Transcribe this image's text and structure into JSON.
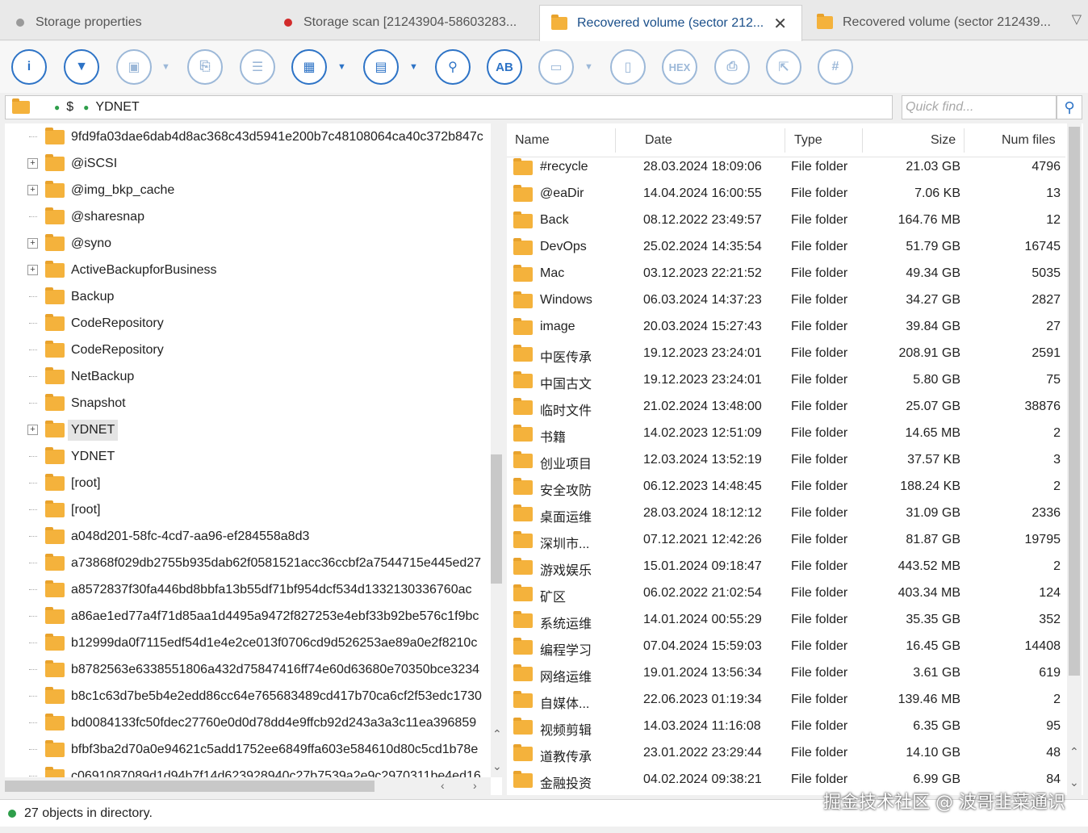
{
  "tabs": [
    {
      "label": "Storage properties",
      "dot_color": "#9a9a9a"
    },
    {
      "label": "Storage scan [21243904-58603283...",
      "dot_color": "#d22b2b"
    },
    {
      "label": "Recovered volume (sector 212...",
      "active": true
    },
    {
      "label": "Recovered volume (sector 212439..."
    }
  ],
  "toolbar": {
    "buttons": [
      {
        "icon": "info-icon",
        "glyph": "i"
      },
      {
        "icon": "filter-icon",
        "glyph": "▼"
      },
      {
        "icon": "save-icon",
        "glyph": "▣"
      },
      {
        "icon": "save-file-icon",
        "glyph": "⎘"
      },
      {
        "icon": "list-icon",
        "glyph": "☰"
      },
      {
        "icon": "view-grid-icon",
        "glyph": "▦"
      },
      {
        "icon": "view-details-icon",
        "glyph": "▤"
      },
      {
        "icon": "binoculars-icon",
        "glyph": "⚲"
      },
      {
        "icon": "text-search-icon",
        "glyph": "AB"
      },
      {
        "icon": "preview-icon",
        "glyph": "▭"
      },
      {
        "icon": "document-icon",
        "glyph": "▯"
      },
      {
        "icon": "hex-icon",
        "glyph": "HEX"
      },
      {
        "icon": "print-icon",
        "glyph": "⎙"
      },
      {
        "icon": "export-icon",
        "glyph": "⇱"
      },
      {
        "icon": "hash-icon",
        "glyph": "#"
      }
    ]
  },
  "path": {
    "root": "$",
    "current": "YDNET"
  },
  "search": {
    "placeholder": "Quick find..."
  },
  "tree": {
    "items": [
      {
        "label": "9fd9fa03dae6dab4d8ac368c43d5941e200b7c48108064ca40c372b847c",
        "expandable": false
      },
      {
        "label": "@iSCSI",
        "expandable": true
      },
      {
        "label": "@img_bkp_cache",
        "expandable": true
      },
      {
        "label": "@sharesnap",
        "expandable": false
      },
      {
        "label": "@syno",
        "expandable": true
      },
      {
        "label": "ActiveBackupforBusiness",
        "expandable": true
      },
      {
        "label": "Backup",
        "expandable": false
      },
      {
        "label": "CodeRepository",
        "expandable": false
      },
      {
        "label": "CodeRepository",
        "expandable": false
      },
      {
        "label": "NetBackup",
        "expandable": false
      },
      {
        "label": "Snapshot",
        "expandable": false
      },
      {
        "label": "YDNET",
        "expandable": true,
        "selected": true
      },
      {
        "label": "YDNET",
        "expandable": false
      },
      {
        "label": "[root]",
        "expandable": false
      },
      {
        "label": "[root]",
        "expandable": false
      },
      {
        "label": "a048d201-58fc-4cd7-aa96-ef284558a8d3",
        "expandable": false
      },
      {
        "label": "a73868f029db2755b935dab62f0581521acc36ccbf2a7544715e445ed27",
        "expandable": false
      },
      {
        "label": "a8572837f30fa446bd8bbfa13b55df71bf954dcf534d1332130336760ac",
        "expandable": false
      },
      {
        "label": "a86ae1ed77a4f71d85aa1d4495a9472f827253e4ebf33b92be576c1f9bc",
        "expandable": false
      },
      {
        "label": "b12999da0f7115edf54d1e4e2ce013f0706cd9d526253ae89a0e2f8210c",
        "expandable": false
      },
      {
        "label": "b8782563e6338551806a432d75847416ff74e60d63680e70350bce3234",
        "expandable": false
      },
      {
        "label": "b8c1c63d7be5b4e2edd86cc64e765683489cd417b70ca6cf2f53edc1730",
        "expandable": false
      },
      {
        "label": "bd0084133fc50fdec27760e0d0d78dd4e9ffcb92d243a3a3c11ea396859",
        "expandable": false
      },
      {
        "label": "bfbf3ba2d70a0e94621c5add1752ee6849ffa603e584610d80c5cd1b78e",
        "expandable": false
      },
      {
        "label": "c0691087089d1d94b7f14d623928940c27b7539a2e9c2970311be4ed16",
        "expandable": false
      }
    ]
  },
  "list": {
    "columns": {
      "name": "Name",
      "date": "Date",
      "type": "Type",
      "size": "Size",
      "num_files": "Num files"
    },
    "rows": [
      {
        "name": "#recycle",
        "date": "28.03.2024 18:09:06",
        "type": "File folder",
        "size": "21.03 GB",
        "num": "4796"
      },
      {
        "name": "@eaDir",
        "date": "14.04.2024 16:00:55",
        "type": "File folder",
        "size": "7.06 KB",
        "num": "13"
      },
      {
        "name": "Back",
        "date": "08.12.2022 23:49:57",
        "type": "File folder",
        "size": "164.76 MB",
        "num": "12"
      },
      {
        "name": "DevOps",
        "date": "25.02.2024 14:35:54",
        "type": "File folder",
        "size": "51.79 GB",
        "num": "16745"
      },
      {
        "name": "Mac",
        "date": "03.12.2023 22:21:52",
        "type": "File folder",
        "size": "49.34 GB",
        "num": "5035"
      },
      {
        "name": "Windows",
        "date": "06.03.2024 14:37:23",
        "type": "File folder",
        "size": "34.27 GB",
        "num": "2827"
      },
      {
        "name": "image",
        "date": "20.03.2024 15:27:43",
        "type": "File folder",
        "size": "39.84 GB",
        "num": "27"
      },
      {
        "name": "中医传承",
        "date": "19.12.2023 23:24:01",
        "type": "File folder",
        "size": "208.91 GB",
        "num": "2591"
      },
      {
        "name": "中国古文",
        "date": "19.12.2023 23:24:01",
        "type": "File folder",
        "size": "5.80 GB",
        "num": "75"
      },
      {
        "name": "临时文件",
        "date": "21.02.2024 13:48:00",
        "type": "File folder",
        "size": "25.07 GB",
        "num": "38876"
      },
      {
        "name": "书籍",
        "date": "14.02.2023 12:51:09",
        "type": "File folder",
        "size": "14.65 MB",
        "num": "2"
      },
      {
        "name": "创业项目",
        "date": "12.03.2024 13:52:19",
        "type": "File folder",
        "size": "37.57 KB",
        "num": "3"
      },
      {
        "name": "安全攻防",
        "date": "06.12.2023 14:48:45",
        "type": "File folder",
        "size": "188.24 KB",
        "num": "2"
      },
      {
        "name": "桌面运维",
        "date": "28.03.2024 18:12:12",
        "type": "File folder",
        "size": "31.09 GB",
        "num": "2336"
      },
      {
        "name": "深圳市...",
        "date": "07.12.2021 12:42:26",
        "type": "File folder",
        "size": "81.87 GB",
        "num": "19795"
      },
      {
        "name": "游戏娱乐",
        "date": "15.01.2024 09:18:47",
        "type": "File folder",
        "size": "443.52 MB",
        "num": "2"
      },
      {
        "name": "矿区",
        "date": "06.02.2022 21:02:54",
        "type": "File folder",
        "size": "403.34 MB",
        "num": "124"
      },
      {
        "name": "系统运维",
        "date": "14.01.2024 00:55:29",
        "type": "File folder",
        "size": "35.35 GB",
        "num": "352"
      },
      {
        "name": "编程学习",
        "date": "07.04.2024 15:59:03",
        "type": "File folder",
        "size": "16.45 GB",
        "num": "14408"
      },
      {
        "name": "网络运维",
        "date": "19.01.2024 13:56:34",
        "type": "File folder",
        "size": "3.61 GB",
        "num": "619"
      },
      {
        "name": "自媒体...",
        "date": "22.06.2023 01:19:34",
        "type": "File folder",
        "size": "139.46 MB",
        "num": "2"
      },
      {
        "name": "视频剪辑",
        "date": "14.03.2024 11:16:08",
        "type": "File folder",
        "size": "6.35 GB",
        "num": "95"
      },
      {
        "name": "道教传承",
        "date": "23.01.2022 23:29:44",
        "type": "File folder",
        "size": "14.10 GB",
        "num": "48"
      },
      {
        "name": "金融投资",
        "date": "04.02.2024 09:38:21",
        "type": "File folder",
        "size": "6.99 GB",
        "num": "84"
      }
    ]
  },
  "status": {
    "text": "27 objects in directory."
  },
  "watermark": "掘金技术社区 @ 波哥韭菜通识"
}
